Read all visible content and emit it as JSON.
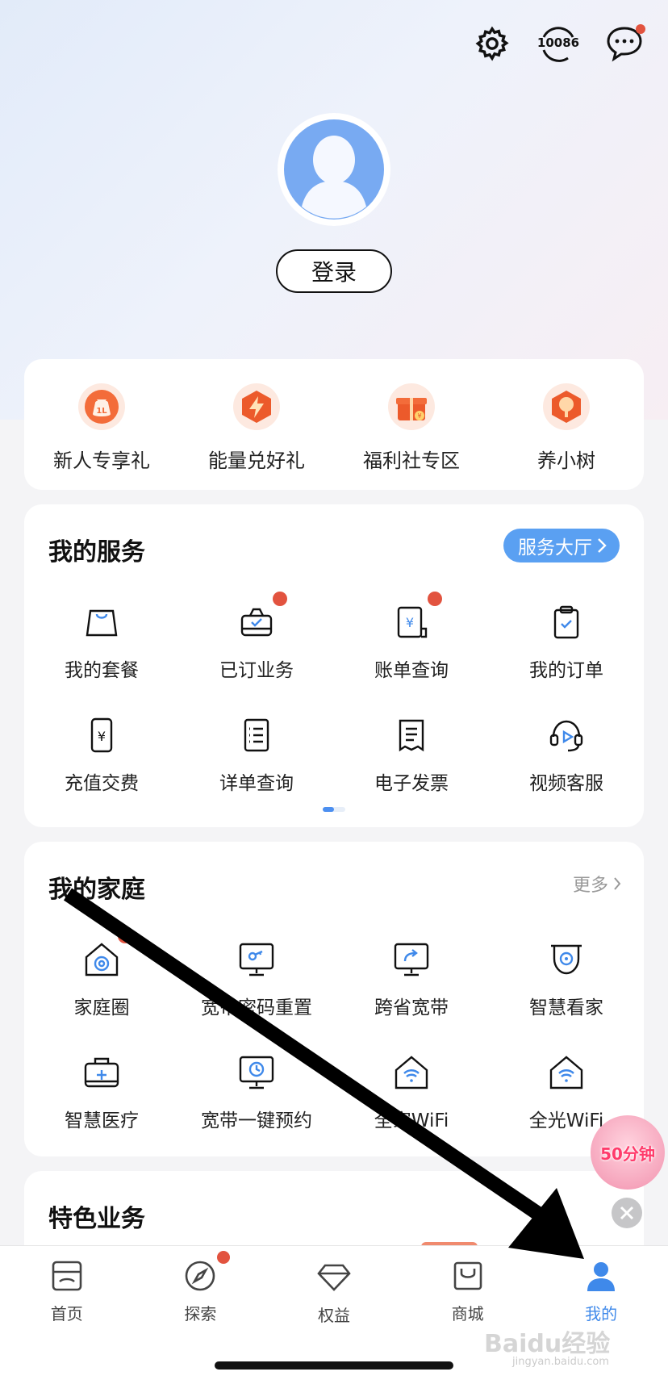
{
  "header": {
    "hotline_text": "10086"
  },
  "profile": {
    "login_label": "登录"
  },
  "promos": [
    {
      "label": "新人专享礼",
      "icon": "lucky-bag-icon"
    },
    {
      "label": "能量兑好礼",
      "icon": "energy-bolt-icon"
    },
    {
      "label": "福利社专区",
      "icon": "gift-box-icon"
    },
    {
      "label": "养小树",
      "icon": "tree-icon"
    }
  ],
  "services": {
    "title": "我的服务",
    "hall_button": "服务大厅",
    "items": [
      {
        "label": "我的套餐",
        "icon": "bag-icon",
        "dot": false
      },
      {
        "label": "已订业务",
        "icon": "subscription-icon",
        "dot": true
      },
      {
        "label": "账单查询",
        "icon": "bill-icon",
        "dot": true
      },
      {
        "label": "我的订单",
        "icon": "clipboard-icon",
        "dot": false
      },
      {
        "label": "充值交费",
        "icon": "phone-yuan-icon",
        "dot": false
      },
      {
        "label": "详单查询",
        "icon": "list-detail-icon",
        "dot": false
      },
      {
        "label": "电子发票",
        "icon": "invoice-icon",
        "dot": false
      },
      {
        "label": "视频客服",
        "icon": "headset-icon",
        "dot": false
      }
    ]
  },
  "family": {
    "title": "我的家庭",
    "more_label": "更多",
    "items": [
      {
        "label": "家庭圈",
        "icon": "home-circle-icon",
        "dot": true
      },
      {
        "label": "宽带密码重置",
        "icon": "monitor-key-icon",
        "dot": false
      },
      {
        "label": "跨省宽带",
        "icon": "monitor-share-icon",
        "dot": false
      },
      {
        "label": "智慧看家",
        "icon": "camera-icon",
        "dot": false
      },
      {
        "label": "智慧医疗",
        "icon": "medical-kit-icon",
        "dot": false
      },
      {
        "label": "宽带一键预约",
        "icon": "monitor-clock-icon",
        "dot": false
      },
      {
        "label": "全家WiFi",
        "icon": "home-wifi-icon",
        "dot": false
      },
      {
        "label": "全光WiFi",
        "icon": "home-wifi-icon",
        "dot": false
      }
    ]
  },
  "feature": {
    "title": "特色业务"
  },
  "float_ad": {
    "label": "50分钟"
  },
  "bottom_nav": [
    {
      "label": "首页",
      "icon": "store-icon",
      "active": false,
      "dot": false
    },
    {
      "label": "探索",
      "icon": "compass-icon",
      "active": false,
      "dot": true
    },
    {
      "label": "权益",
      "icon": "diamond-icon",
      "active": false,
      "dot": false
    },
    {
      "label": "商城",
      "icon": "shopping-bag-icon",
      "active": false,
      "dot": false
    },
    {
      "label": "我的",
      "icon": "person-icon",
      "active": true,
      "dot": false
    }
  ],
  "watermark": {
    "brand": "Baidu经验",
    "domain": "jingyan.baidu.com"
  },
  "colors": {
    "accent_blue": "#3f89ea",
    "hall_button": "#5aa0f2",
    "badge_red": "#e2533f",
    "promo_orange": "#ec5a2b"
  }
}
